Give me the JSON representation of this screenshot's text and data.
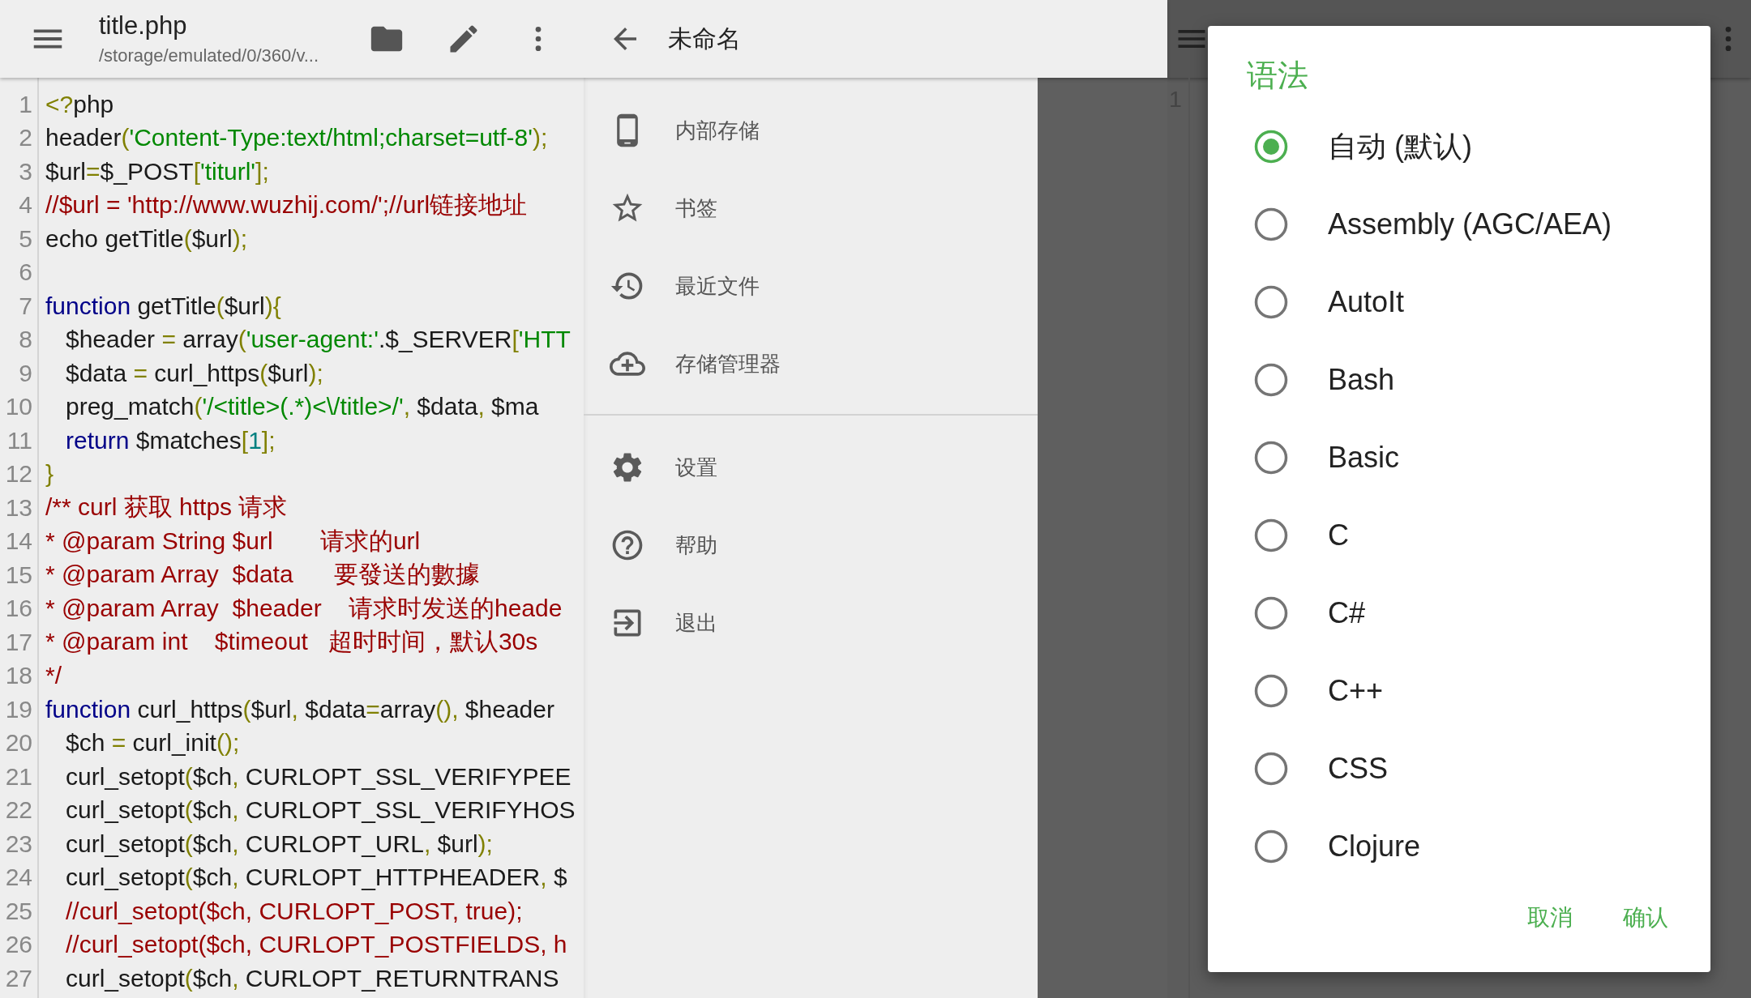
{
  "editor": {
    "toolbar": {
      "title": "title.php",
      "subtitle": "/storage/emulated/0/360/v..."
    },
    "lines": [
      {
        "number": "1",
        "tokens": [
          {
            "kind": "punct",
            "text": "<?"
          },
          {
            "kind": "plain",
            "text": "php"
          }
        ]
      },
      {
        "number": "2",
        "tokens": [
          {
            "kind": "plain",
            "text": "header"
          },
          {
            "kind": "punct",
            "text": "("
          },
          {
            "kind": "string",
            "text": "'Content-Type:text/html;charset=utf-8'"
          },
          {
            "kind": "punct",
            "text": ");"
          }
        ]
      },
      {
        "number": "3",
        "tokens": [
          {
            "kind": "plain",
            "text": "$url"
          },
          {
            "kind": "punct",
            "text": "="
          },
          {
            "kind": "plain",
            "text": "$_POST"
          },
          {
            "kind": "punct",
            "text": "["
          },
          {
            "kind": "string",
            "text": "'titurl'"
          },
          {
            "kind": "punct",
            "text": "];"
          }
        ]
      },
      {
        "number": "4",
        "tokens": [
          {
            "kind": "comment",
            "text": "//$url = 'http://www.wuzhij.com/';//url链接地址"
          }
        ]
      },
      {
        "number": "5",
        "tokens": [
          {
            "kind": "plain",
            "text": "echo getTitle"
          },
          {
            "kind": "punct",
            "text": "("
          },
          {
            "kind": "plain",
            "text": "$url"
          },
          {
            "kind": "punct",
            "text": ");"
          }
        ]
      },
      {
        "number": "6"
      },
      {
        "number": "7",
        "tokens": [
          {
            "kind": "keyword",
            "text": "function"
          },
          {
            "kind": "plain",
            "text": " getTitle"
          },
          {
            "kind": "punct",
            "text": "("
          },
          {
            "kind": "plain",
            "text": "$url"
          },
          {
            "kind": "punct",
            "text": "){"
          }
        ]
      },
      {
        "number": "8",
        "tokens": [
          {
            "kind": "plain",
            "text": "   $header "
          },
          {
            "kind": "punct",
            "text": "="
          },
          {
            "kind": "plain",
            "text": " array"
          },
          {
            "kind": "punct",
            "text": "("
          },
          {
            "kind": "string",
            "text": "'user-agent:'"
          },
          {
            "kind": "plain",
            "text": ".$_SERVER"
          },
          {
            "kind": "punct",
            "text": "["
          },
          {
            "kind": "string",
            "text": "'HTT"
          }
        ]
      },
      {
        "number": "9",
        "tokens": [
          {
            "kind": "plain",
            "text": "   $data "
          },
          {
            "kind": "punct",
            "text": "="
          },
          {
            "kind": "plain",
            "text": " curl_https"
          },
          {
            "kind": "punct",
            "text": "("
          },
          {
            "kind": "plain",
            "text": "$url"
          },
          {
            "kind": "punct",
            "text": ");"
          }
        ]
      },
      {
        "number": "10",
        "tokens": [
          {
            "kind": "plain",
            "text": "   preg_match"
          },
          {
            "kind": "punct",
            "text": "("
          },
          {
            "kind": "string",
            "text": "'/<title>(.*)<\\/title>/'"
          },
          {
            "kind": "punct",
            "text": ","
          },
          {
            "kind": "plain",
            "text": " $data"
          },
          {
            "kind": "punct",
            "text": ","
          },
          {
            "kind": "plain",
            "text": " $ma"
          }
        ]
      },
      {
        "number": "11",
        "tokens": [
          {
            "kind": "keyword",
            "text": "   return"
          },
          {
            "kind": "plain",
            "text": " $matches"
          },
          {
            "kind": "punct",
            "text": "["
          },
          {
            "kind": "number",
            "text": "1"
          },
          {
            "kind": "punct",
            "text": "];"
          }
        ]
      },
      {
        "number": "12",
        "tokens": [
          {
            "kind": "punct",
            "text": "}"
          }
        ]
      },
      {
        "number": "13",
        "tokens": [
          {
            "kind": "comment",
            "text": "/** curl 获取 https 请求"
          }
        ]
      },
      {
        "number": "14",
        "tokens": [
          {
            "kind": "comment",
            "text": "* @param String $url       请求的url"
          }
        ]
      },
      {
        "number": "15",
        "tokens": [
          {
            "kind": "comment",
            "text": "* @param Array  $data      要發送的數據"
          }
        ]
      },
      {
        "number": "16",
        "tokens": [
          {
            "kind": "comment",
            "text": "* @param Array  $header    请求时发送的heade"
          }
        ]
      },
      {
        "number": "17",
        "tokens": [
          {
            "kind": "comment",
            "text": "* @param int    $timeout   超时时间，默认30s"
          }
        ]
      },
      {
        "number": "18",
        "tokens": [
          {
            "kind": "comment",
            "text": "*/"
          }
        ]
      },
      {
        "number": "19",
        "tokens": [
          {
            "kind": "keyword",
            "text": "function"
          },
          {
            "kind": "plain",
            "text": " curl_https"
          },
          {
            "kind": "punct",
            "text": "("
          },
          {
            "kind": "plain",
            "text": "$url"
          },
          {
            "kind": "punct",
            "text": ","
          },
          {
            "kind": "plain",
            "text": " $data"
          },
          {
            "kind": "punct",
            "text": "="
          },
          {
            "kind": "plain",
            "text": "array"
          },
          {
            "kind": "punct",
            "text": "(),"
          },
          {
            "kind": "plain",
            "text": " $header"
          }
        ]
      },
      {
        "number": "20",
        "tokens": [
          {
            "kind": "plain",
            "text": "   $ch "
          },
          {
            "kind": "punct",
            "text": "="
          },
          {
            "kind": "plain",
            "text": " curl_init"
          },
          {
            "kind": "punct",
            "text": "();"
          }
        ]
      },
      {
        "number": "21",
        "tokens": [
          {
            "kind": "plain",
            "text": "   curl_setopt"
          },
          {
            "kind": "punct",
            "text": "("
          },
          {
            "kind": "plain",
            "text": "$ch"
          },
          {
            "kind": "punct",
            "text": ","
          },
          {
            "kind": "plain",
            "text": " CURLOPT_SSL_VERIFYPEE"
          }
        ]
      },
      {
        "number": "22",
        "tokens": [
          {
            "kind": "plain",
            "text": "   curl_setopt"
          },
          {
            "kind": "punct",
            "text": "("
          },
          {
            "kind": "plain",
            "text": "$ch"
          },
          {
            "kind": "punct",
            "text": ","
          },
          {
            "kind": "plain",
            "text": " CURLOPT_SSL_VERIFYHOS"
          }
        ]
      },
      {
        "number": "23",
        "tokens": [
          {
            "kind": "plain",
            "text": "   curl_setopt"
          },
          {
            "kind": "punct",
            "text": "("
          },
          {
            "kind": "plain",
            "text": "$ch"
          },
          {
            "kind": "punct",
            "text": ","
          },
          {
            "kind": "plain",
            "text": " CURLOPT_URL"
          },
          {
            "kind": "punct",
            "text": ","
          },
          {
            "kind": "plain",
            "text": " $url"
          },
          {
            "kind": "punct",
            "text": ");"
          }
        ]
      },
      {
        "number": "24",
        "tokens": [
          {
            "kind": "plain",
            "text": "   curl_setopt"
          },
          {
            "kind": "punct",
            "text": "("
          },
          {
            "kind": "plain",
            "text": "$ch"
          },
          {
            "kind": "punct",
            "text": ","
          },
          {
            "kind": "plain",
            "text": " CURLOPT_HTTPHEADER"
          },
          {
            "kind": "punct",
            "text": ","
          },
          {
            "kind": "plain",
            "text": " $"
          }
        ]
      },
      {
        "number": "25",
        "tokens": [
          {
            "kind": "comment",
            "text": "   //curl_setopt($ch, CURLOPT_POST, true);"
          }
        ]
      },
      {
        "number": "26",
        "tokens": [
          {
            "kind": "comment",
            "text": "   //curl_setopt($ch, CURLOPT_POSTFIELDS, h"
          }
        ]
      },
      {
        "number": "27",
        "tokens": [
          {
            "kind": "plain",
            "text": "   curl_setopt"
          },
          {
            "kind": "punct",
            "text": "("
          },
          {
            "kind": "plain",
            "text": "$ch"
          },
          {
            "kind": "punct",
            "text": ","
          },
          {
            "kind": "plain",
            "text": " CURLOPT_RETURNTRANS"
          }
        ]
      }
    ]
  },
  "drawer": {
    "title": "未命名",
    "sections": [
      {
        "items": [
          {
            "label": "内部存储"
          },
          {
            "label": "书签"
          },
          {
            "label": "最近文件"
          },
          {
            "label": "存储管理器"
          }
        ]
      },
      {
        "items": [
          {
            "label": "设置"
          },
          {
            "label": "帮助"
          },
          {
            "label": "退出"
          }
        ]
      }
    ]
  },
  "background_editor": {
    "line_number": "1"
  },
  "dialog": {
    "title": "语法",
    "options": [
      {
        "label": "自动 (默认)",
        "selected": true
      },
      {
        "label": "Assembly (AGC/AEA)",
        "selected": false
      },
      {
        "label": "AutoIt",
        "selected": false
      },
      {
        "label": "Bash",
        "selected": false
      },
      {
        "label": "Basic",
        "selected": false
      },
      {
        "label": "C",
        "selected": false
      },
      {
        "label": "C#",
        "selected": false
      },
      {
        "label": "C++",
        "selected": false
      },
      {
        "label": "CSS",
        "selected": false
      },
      {
        "label": "Clojure",
        "selected": false
      }
    ],
    "buttons": [
      "取消",
      "确认"
    ]
  }
}
